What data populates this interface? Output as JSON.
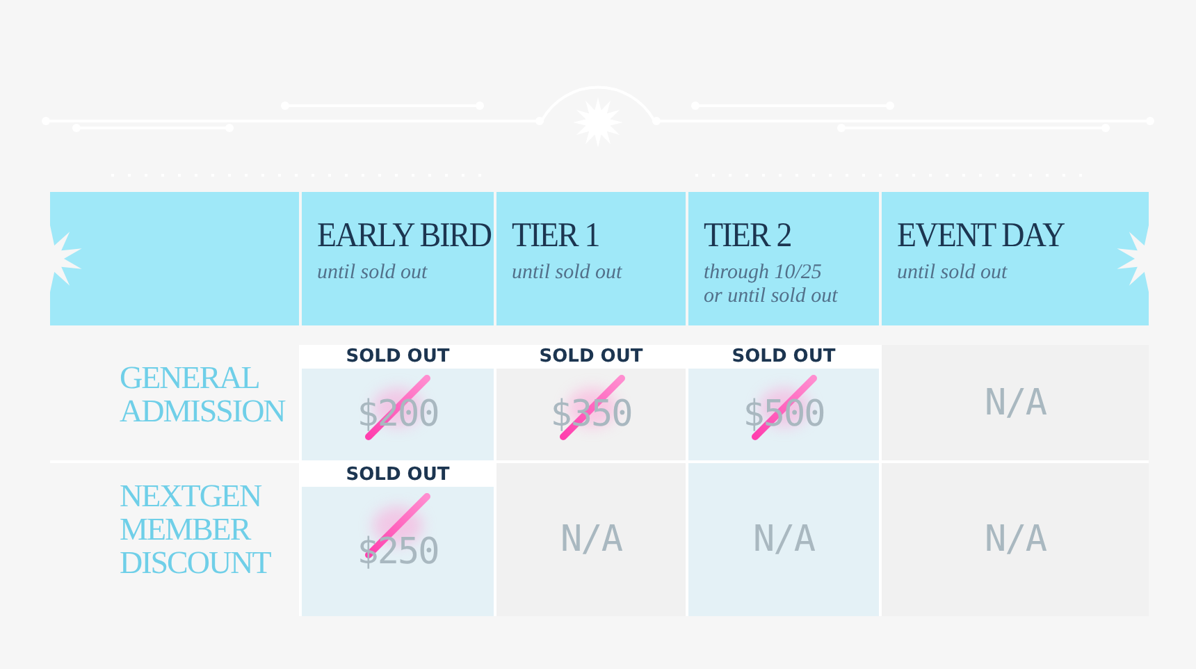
{
  "columns": [
    {
      "title": "EARLY BIRD",
      "subtitle": "until sold out"
    },
    {
      "title": "TIER 1",
      "subtitle": "until sold out"
    },
    {
      "title": "TIER 2",
      "subtitle": "through 10/25\nor until sold out"
    },
    {
      "title": "EVENT DAY",
      "subtitle": "until sold out"
    }
  ],
  "rows": [
    {
      "label": "GENERAL\nADMISSION",
      "cells": [
        {
          "kind": "price",
          "text": "$200",
          "sold_out": true,
          "badge": "SOLD OUT",
          "shaded": true
        },
        {
          "kind": "price",
          "text": "$350",
          "sold_out": true,
          "badge": "SOLD OUT",
          "shaded": false
        },
        {
          "kind": "price",
          "text": "$500",
          "sold_out": true,
          "badge": "SOLD OUT",
          "shaded": true
        },
        {
          "kind": "na",
          "text": "N/A",
          "shaded": false
        }
      ]
    },
    {
      "label": "NEXTGEN\nMEMBER\nDISCOUNT",
      "cells": [
        {
          "kind": "price",
          "text": "$250",
          "sold_out": true,
          "badge": "SOLD OUT",
          "shaded": true
        },
        {
          "kind": "na",
          "text": "N/A",
          "shaded": false
        },
        {
          "kind": "na",
          "text": "N/A",
          "shaded": true
        },
        {
          "kind": "na",
          "text": "N/A",
          "shaded": false
        }
      ]
    }
  ]
}
